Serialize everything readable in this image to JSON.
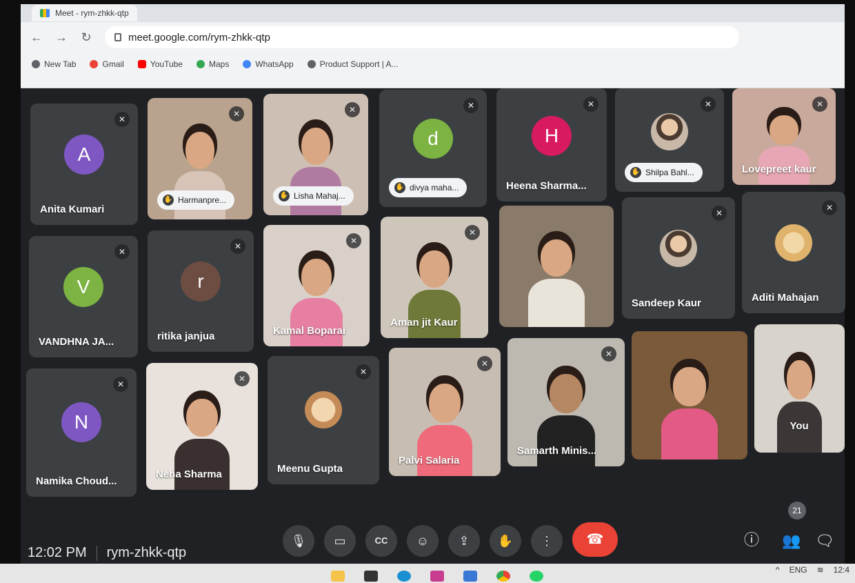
{
  "browser": {
    "tab_title": "Meet - rym-zhkk-qtp",
    "url": "meet.google.com/rym-zhkk-qtp",
    "bookmarks": [
      {
        "label": "New Tab",
        "color": "#5f6368"
      },
      {
        "label": "Gmail",
        "color": "#ea4335"
      },
      {
        "label": "YouTube",
        "color": "#ff0000"
      },
      {
        "label": "Maps",
        "color": "#34a853"
      },
      {
        "label": "WhatsApp",
        "color": "#4285f4"
      },
      {
        "label": "Product Support | A...",
        "color": "#5f6368"
      }
    ]
  },
  "participants": [
    {
      "name": "Anita Kumari",
      "avatar_letter": "A",
      "avatar_color": "#7e57c2",
      "muted": true
    },
    {
      "name": "Harmanpre...",
      "hand_raised": true,
      "muted": true
    },
    {
      "name": "Lisha Mahaj...",
      "hand_raised": true,
      "muted": true
    },
    {
      "name": "divya maha...",
      "avatar_letter": "d",
      "avatar_color": "#7cb342",
      "hand_raised": true,
      "muted": true
    },
    {
      "name": "Heena Sharma...",
      "avatar_letter": "H",
      "avatar_color": "#d81b60",
      "muted": true
    },
    {
      "name": "Shilpa Bahl...",
      "hand_raised": true,
      "muted": true
    },
    {
      "name": "Lovepreet kaur",
      "muted": true
    },
    {
      "name": "VANDHNA JA...",
      "avatar_letter": "V",
      "avatar_color": "#7cb342",
      "muted": true
    },
    {
      "name": "ritika janjua",
      "avatar_letter": "r",
      "avatar_color": "#6d4c41",
      "muted": true
    },
    {
      "name": "Kamal Boparai",
      "muted": true
    },
    {
      "name": "Aman jit Kaur",
      "muted": true
    },
    {
      "name": "",
      "muted": false
    },
    {
      "name": "Sandeep Kaur",
      "muted": true
    },
    {
      "name": "Aditi Mahajan",
      "muted": true
    },
    {
      "name": "Namika Choud...",
      "avatar_letter": "N",
      "avatar_color": "#7e57c2",
      "muted": true
    },
    {
      "name": "Neha Sharma",
      "muted": true
    },
    {
      "name": "Meenu Gupta",
      "muted": true
    },
    {
      "name": "Palvi Salaria",
      "muted": true
    },
    {
      "name": "Samarth Minis...",
      "muted": true
    },
    {
      "name": "",
      "muted": false
    },
    {
      "name": "You",
      "muted": false
    }
  ],
  "meeting": {
    "time": "12:02 PM",
    "code": "rym-zhkk-qtp",
    "participant_count": "21"
  },
  "controls": [
    "mic-icon",
    "camera-icon",
    "captions-icon",
    "emoji-icon",
    "present-icon",
    "raise-hand-icon",
    "more-icon",
    "end-call-icon"
  ],
  "tray": {
    "lang": "ENG",
    "time": "12:4"
  }
}
